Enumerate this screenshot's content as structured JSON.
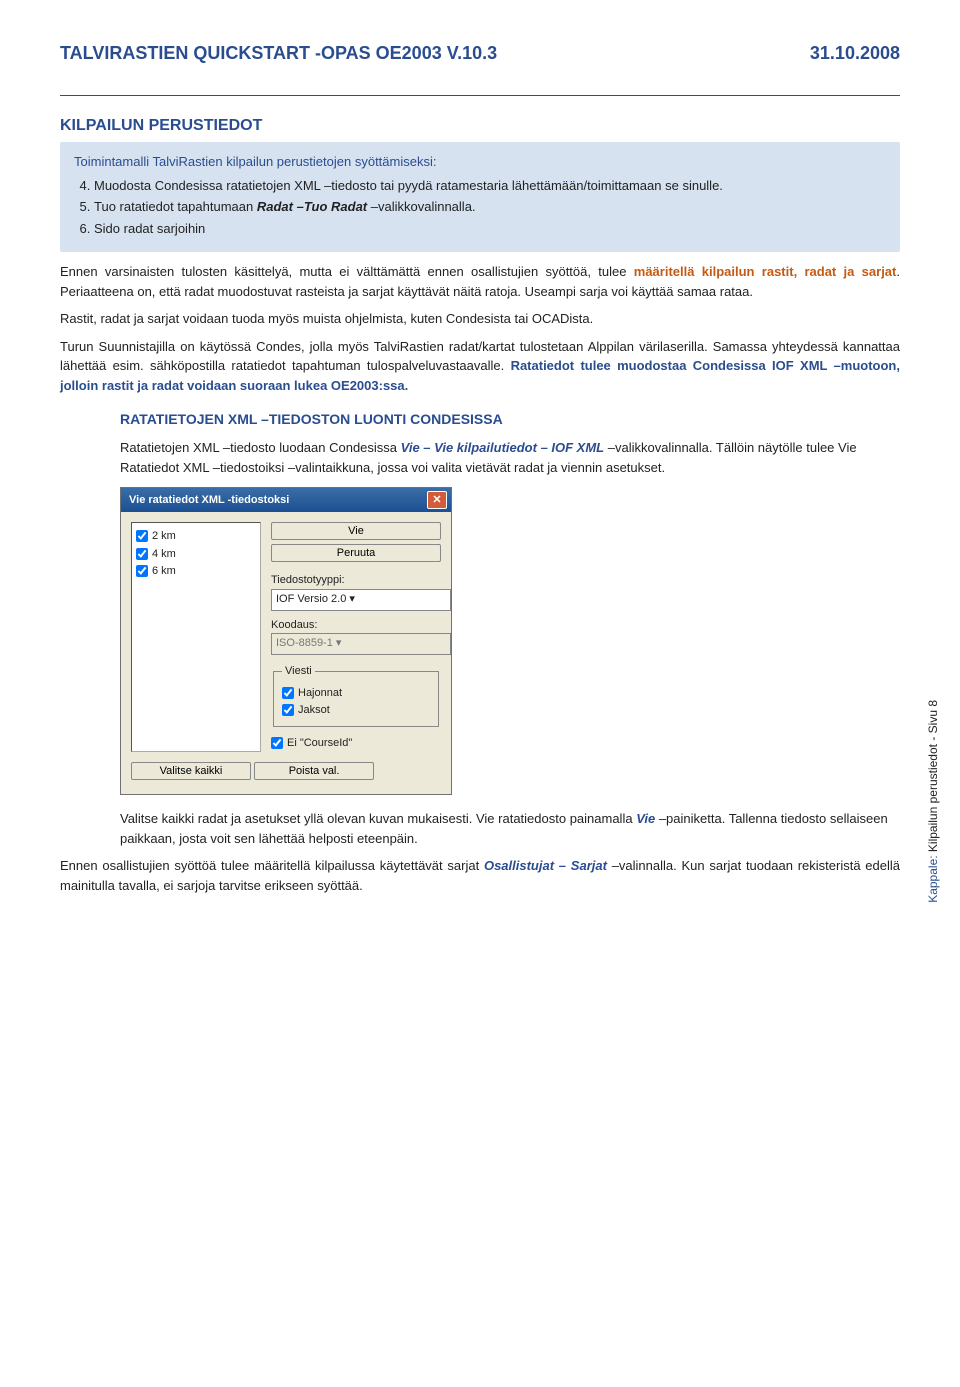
{
  "header": {
    "title": "TALVIRASTIEN QUICKSTART -OPAS OE2003 V.10.3",
    "date": "31.10.2008"
  },
  "section": {
    "heading": "KILPAILUN PERUSTIEDOT"
  },
  "bluebox": {
    "lead": "Toimintamalli TalviRastien kilpailun perustietojen syöttämiseksi:",
    "steps": {
      "s4": "Muodosta Condesissa ratatietojen XML –tiedosto tai pyydä ratamestaria lähettämään/toimittamaan se sinulle.",
      "s5_a": "Tuo ratatiedot tapahtumaan ",
      "s5_b": "Radat –Tuo Radat",
      "s5_c": " –valikkovalinnalla.",
      "s6": "Sido radat sarjoihin"
    }
  },
  "para": {
    "p1_a": "Ennen varsinaisten tulosten käsittelyä, mutta ei välttämättä ennen osallistujien syöttöä, tulee ",
    "p1_b": "määritellä kilpailun rastit, radat ja sarjat",
    "p1_c": ". Periaatteena on, että radat muodostuvat rasteista ja sarjat käyttävät näitä ratoja. Useampi sarja voi käyttää samaa rataa.",
    "p2": "Rastit, radat ja sarjat voidaan tuoda myös muista ohjelmista, kuten Condesista tai OCADista.",
    "p3_a": "Turun Suunnistajilla on käytössä Condes, jolla myös TalviRastien radat/kartat tulostetaan Alppilan värilaserilla. Samassa yhteydessä kannattaa lähettää esim. sähköpostilla ratatiedot tapahtuman tulospalveluvastaavalle. ",
    "p3_b": "Ratatiedot tulee muodostaa Condesissa IOF XML –muotoon, jolloin rastit ja radat voidaan suoraan lukea OE2003:ssa."
  },
  "sub": {
    "heading": "RATATIETOJEN XML –TIEDOSTON LUONTI CONDESISSA",
    "text_a": "Ratatietojen XML –tiedosto luodaan Condesissa ",
    "text_b": "Vie – Vie kilpailutiedot – IOF XML",
    "text_c": " –valikkovalinnalla. Tällöin näytölle tulee Vie Ratatiedot XML –tiedostoiksi –valintaikkuna, jossa voi valita vietävät radat ja viennin asetukset."
  },
  "dialog": {
    "title": "Vie ratatiedot XML -tiedostoksi",
    "routes": {
      "r1": "2 km",
      "r2": "4 km",
      "r3": "6 km"
    },
    "buttons": {
      "vie": "Vie",
      "peruuta": "Peruuta",
      "valitse": "Valitse kaikki",
      "poista": "Poista val."
    },
    "labels": {
      "tyyppi": "Tiedostotyyppi:",
      "tyyppi_val": "IOF Versio 2.0",
      "koodaus": "Koodaus:",
      "koodaus_val": "ISO-8859-1",
      "viesti": "Viesti",
      "hajonnat": "Hajonnat",
      "jaksot": "Jaksot",
      "courseid": "Ei \"CourseId\""
    }
  },
  "after": {
    "p1_a": "Valitse kaikki radat ja asetukset yllä olevan kuvan mukaisesti. Vie ratatiedosto painamalla ",
    "p1_b": "Vie",
    "p1_c": " –painiketta. Tallenna tiedosto sellaiseen paikkaan, josta voit sen lähettää helposti eteenpäin.",
    "p2_a": "Ennen osallistujien syöttöä tulee määritellä kilpailussa käytettävät sarjat ",
    "p2_b": "Osallistujat – Sarjat",
    "p2_c": " –valinnalla. Kun sarjat tuodaan rekisteristä edellä mainitulla tavalla, ei sarjoja tarvitse erikseen syöttää."
  },
  "side": {
    "kappale": "Kappale:",
    "text": " Kilpailun perustiedot - Sivu 8"
  }
}
